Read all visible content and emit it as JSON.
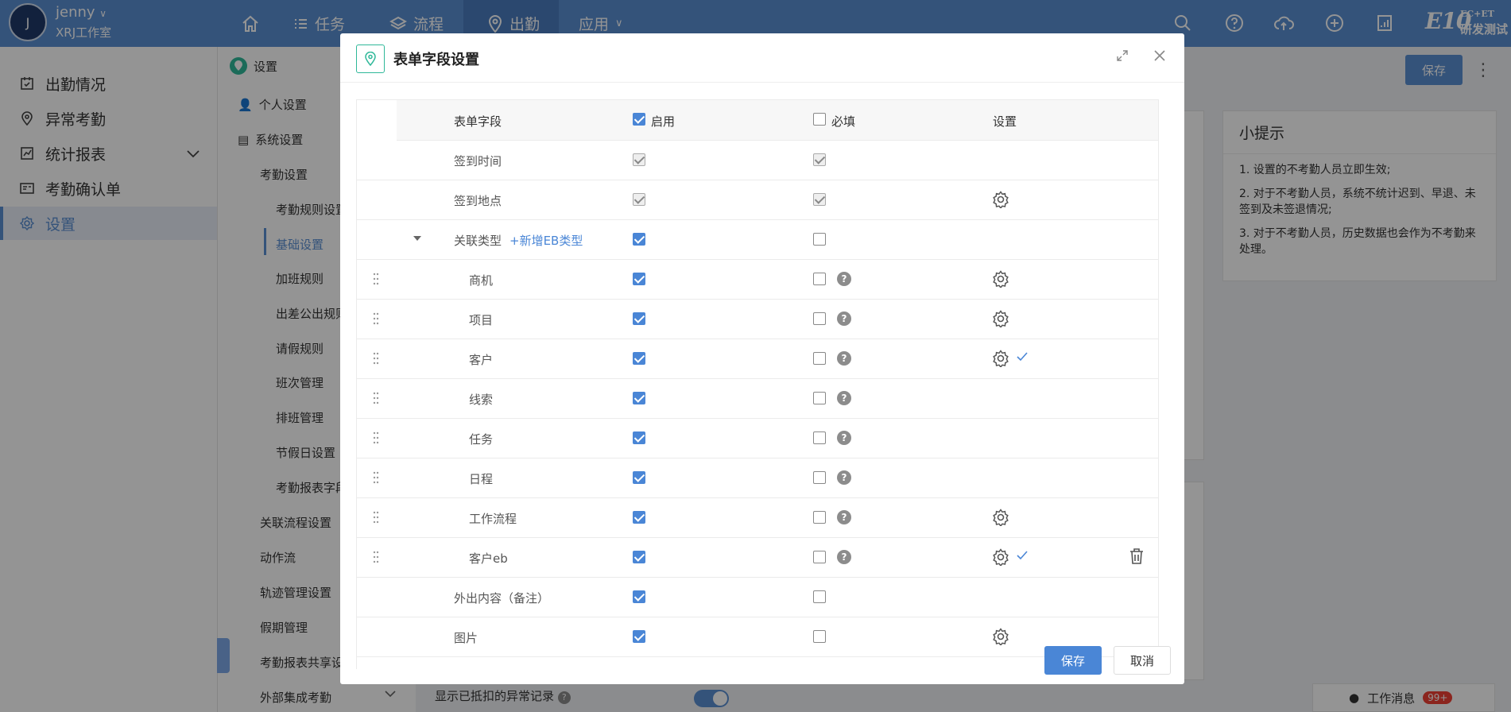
{
  "header": {
    "avatar_initial": "J",
    "username": "jenny",
    "studio": "XRJ工作室",
    "nav": [
      "任务",
      "流程",
      "出勤",
      "应用"
    ],
    "brand_top": "EC+ET",
    "brand_text": "研发测试",
    "brand_mark": "E10"
  },
  "sidebar": {
    "items": [
      {
        "label": "出勤情况",
        "icon": "calendar-check-icon"
      },
      {
        "label": "异常考勤",
        "icon": "location-pin-icon"
      },
      {
        "label": "统计报表",
        "icon": "chart-icon"
      },
      {
        "label": "考勤确认单",
        "icon": "id-card-icon"
      },
      {
        "label": "设置",
        "icon": "gear-icon"
      }
    ]
  },
  "subnav": {
    "title": "设置",
    "personal": "个人设置",
    "system": "系统设置",
    "attendance": "考勤设置",
    "items": [
      "考勤规则设置",
      "基础设置",
      "加班规则",
      "出差公出规则",
      "请假规则",
      "班次管理",
      "排班管理",
      "节假日设置",
      "考勤报表字段"
    ],
    "groups": [
      "关联流程设置",
      "动作流",
      "轨迹管理设置",
      "假期管理",
      "考勤报表共享设置",
      "外部集成考勤"
    ]
  },
  "main": {
    "save_label": "保存",
    "tips_title": "小提示",
    "tips": [
      "1. 设置的不考勤人员立即生效;",
      "2. 对于不考勤人员，系统不统计迟到、早退、未签到及未签退情况;",
      "3. 对于不考勤人员，历史数据也会作为不考勤来处理。"
    ],
    "bottom_label": "显示已抵扣的异常记录",
    "msg_label": "工作消息",
    "msg_badge": "99+"
  },
  "modal": {
    "title": "表单字段设置",
    "columns": {
      "field": "表单字段",
      "enable": "启用",
      "required": "必填",
      "settings": "设置"
    },
    "add_link": "+新增EB类型",
    "rows": [
      {
        "label": "签到时间",
        "enable": "disabled-on",
        "required": "disabled-on",
        "drag": false,
        "help": false,
        "gear": false,
        "tick": false,
        "trash": false,
        "indent": 0
      },
      {
        "label": "签到地点",
        "enable": "disabled-on",
        "required": "disabled-on",
        "drag": false,
        "help": false,
        "gear": true,
        "tick": false,
        "trash": false,
        "indent": 0
      },
      {
        "label": "关联类型",
        "enable": "on",
        "required": "off",
        "drag": false,
        "help": false,
        "gear": false,
        "tick": false,
        "trash": false,
        "indent": 0,
        "caret": true
      },
      {
        "label": "商机",
        "enable": "on",
        "required": "off",
        "drag": true,
        "help": true,
        "gear": true,
        "tick": false,
        "trash": false,
        "indent": 1
      },
      {
        "label": "项目",
        "enable": "on",
        "required": "off",
        "drag": true,
        "help": true,
        "gear": true,
        "tick": false,
        "trash": false,
        "indent": 1
      },
      {
        "label": "客户",
        "enable": "on",
        "required": "off",
        "drag": true,
        "help": true,
        "gear": true,
        "tick": true,
        "trash": false,
        "indent": 1
      },
      {
        "label": "线索",
        "enable": "on",
        "required": "off",
        "drag": true,
        "help": true,
        "gear": false,
        "tick": false,
        "trash": false,
        "indent": 1
      },
      {
        "label": "任务",
        "enable": "on",
        "required": "off",
        "drag": true,
        "help": true,
        "gear": false,
        "tick": false,
        "trash": false,
        "indent": 1
      },
      {
        "label": "日程",
        "enable": "on",
        "required": "off",
        "drag": true,
        "help": true,
        "gear": false,
        "tick": false,
        "trash": false,
        "indent": 1
      },
      {
        "label": "工作流程",
        "enable": "on",
        "required": "off",
        "drag": true,
        "help": true,
        "gear": true,
        "tick": false,
        "trash": false,
        "indent": 1
      },
      {
        "label": "客户eb",
        "enable": "on",
        "required": "off",
        "drag": true,
        "help": true,
        "gear": true,
        "tick": true,
        "trash": true,
        "indent": 1
      },
      {
        "label": "外出内容（备注）",
        "enable": "on",
        "required": "off",
        "drag": false,
        "help": false,
        "gear": false,
        "tick": false,
        "trash": false,
        "indent": 0
      },
      {
        "label": "图片",
        "enable": "on",
        "required": "off",
        "drag": false,
        "help": false,
        "gear": true,
        "tick": false,
        "trash": false,
        "indent": 0
      }
    ],
    "save_label": "保存",
    "cancel_label": "取消"
  },
  "colors": {
    "primary": "#5b8fd3",
    "checkbox": "#4a86d6",
    "accent_green": "#2fb899"
  }
}
